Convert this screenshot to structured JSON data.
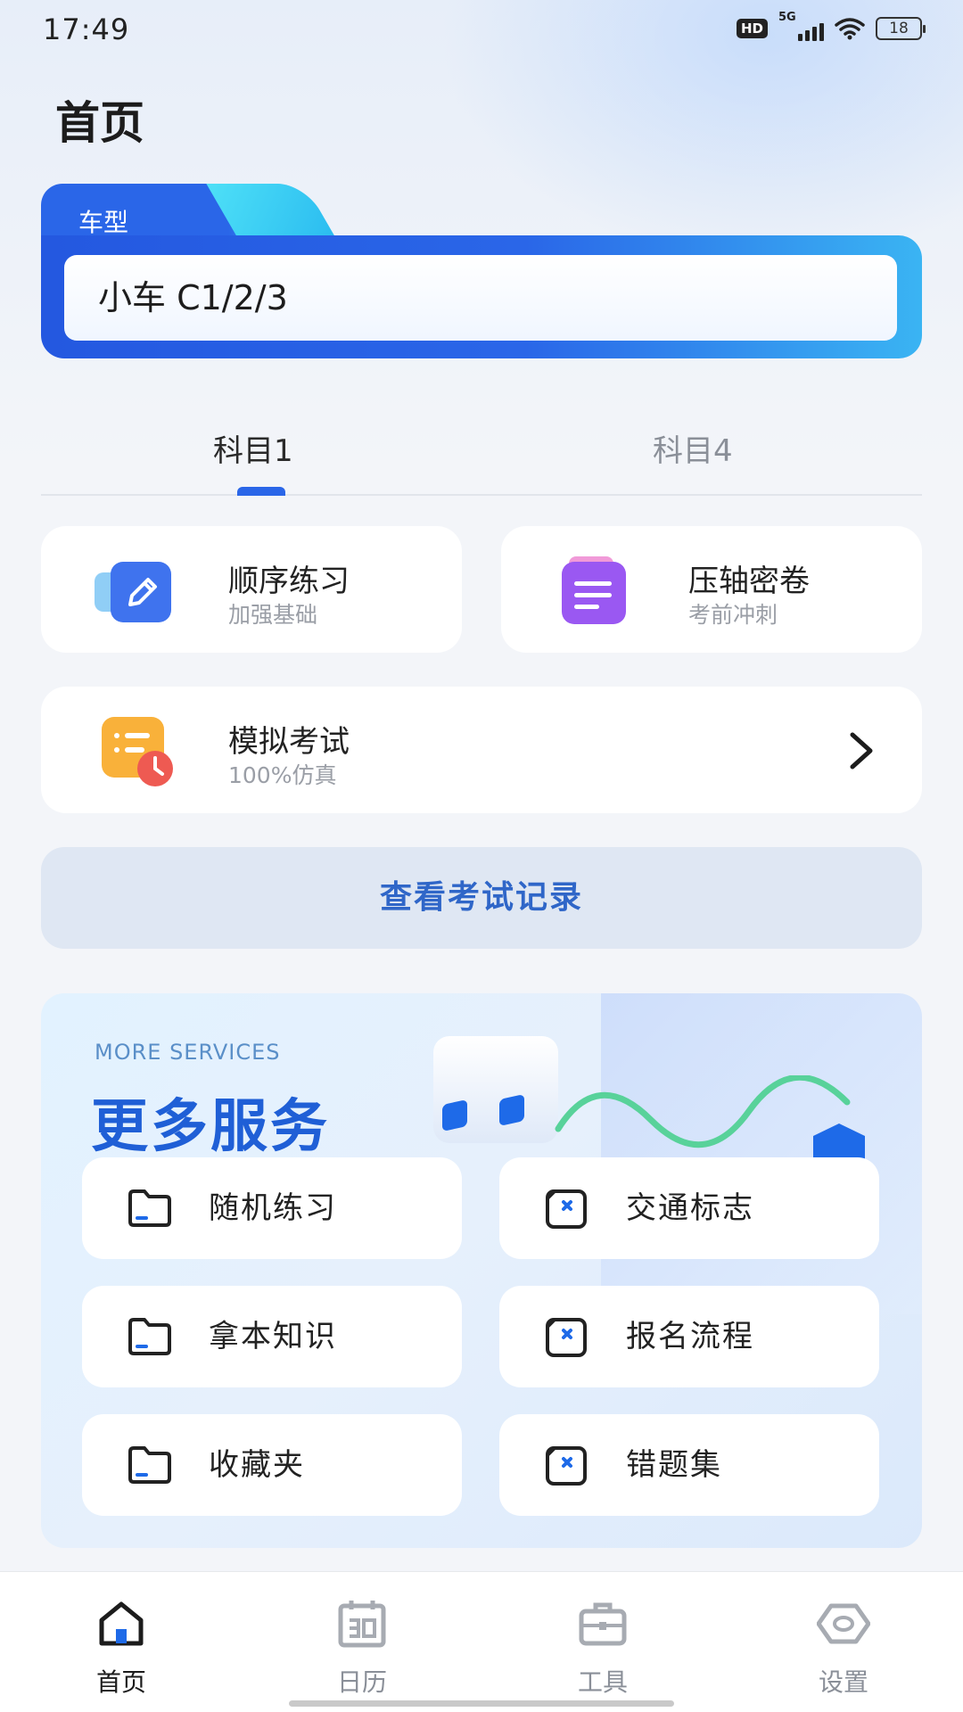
{
  "status_bar": {
    "time": "17:49",
    "hd": "HD",
    "network": "5G",
    "battery": "18"
  },
  "page": {
    "title": "首页"
  },
  "vehicle": {
    "label": "车型",
    "value": "小车 C1/2/3"
  },
  "tabs": [
    {
      "label": "科目1",
      "active": true
    },
    {
      "label": "科目4",
      "active": false
    }
  ],
  "practice": {
    "sequential": {
      "title": "顺序练习",
      "subtitle": "加强基础",
      "icon": "pencil-icon"
    },
    "press_exam": {
      "title": "压轴密卷",
      "subtitle": "考前冲刺",
      "icon": "document-icon"
    },
    "mock_exam": {
      "title": "模拟考试",
      "subtitle": "100%仿真",
      "icon": "exam-clock-icon"
    }
  },
  "records_button": "查看考试记录",
  "services": {
    "en_title": "MORE SERVICES",
    "title": "更多服务",
    "items": [
      {
        "label": "随机练习",
        "icon": "folder-icon"
      },
      {
        "label": "交通标志",
        "icon": "card-x-icon"
      },
      {
        "label": "拿本知识",
        "icon": "folder-icon"
      },
      {
        "label": "报名流程",
        "icon": "card-x-icon"
      },
      {
        "label": "收藏夹",
        "icon": "folder-icon"
      },
      {
        "label": "错题集",
        "icon": "card-x-icon"
      }
    ]
  },
  "bottom_nav": [
    {
      "label": "首页",
      "icon": "home-icon",
      "active": true
    },
    {
      "label": "日历",
      "icon": "calendar-icon",
      "active": false
    },
    {
      "label": "工具",
      "icon": "toolbox-icon",
      "active": false
    },
    {
      "label": "设置",
      "icon": "settings-icon",
      "active": false
    }
  ],
  "colors": {
    "primary": "#2a66e8",
    "accent_cyan": "#35c8f5",
    "records_text": "#2f66c8",
    "inactive_text": "#8a8f98"
  }
}
